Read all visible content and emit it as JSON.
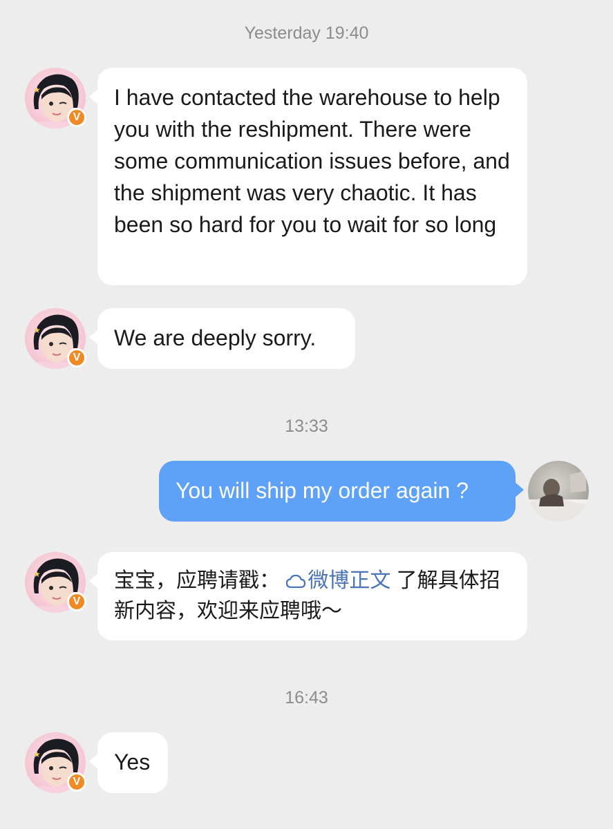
{
  "timestamps": {
    "t1": "Yesterday 19:40",
    "t2": "13:33",
    "t3": "16:43"
  },
  "avatar_badge": "V",
  "messages": {
    "m1": "I have contacted the warehouse to help you with the reshipment. There were some communication issues before, and the shipment was very chaotic. It has been so hard for you to wait for so long",
    "m2": "We are deeply sorry.",
    "m3": "You will ship my order again ?",
    "m4_prefix": "宝宝，应聘请戳：",
    "m4_link": "微博正文",
    "m4_suffix": " 了解具体招新内容，欢迎来应聘哦～",
    "m5": "Yes"
  },
  "icons": {
    "link": "cloud-link-icon",
    "verified": "verified-badge-icon"
  },
  "colors": {
    "background": "#ededed",
    "incoming_bubble": "#ffffff",
    "outgoing_bubble": "#5ea1f8",
    "timestamp_text": "#8c8c8c",
    "link_text": "#4a74b7",
    "verified_badge": "#f08a24"
  }
}
